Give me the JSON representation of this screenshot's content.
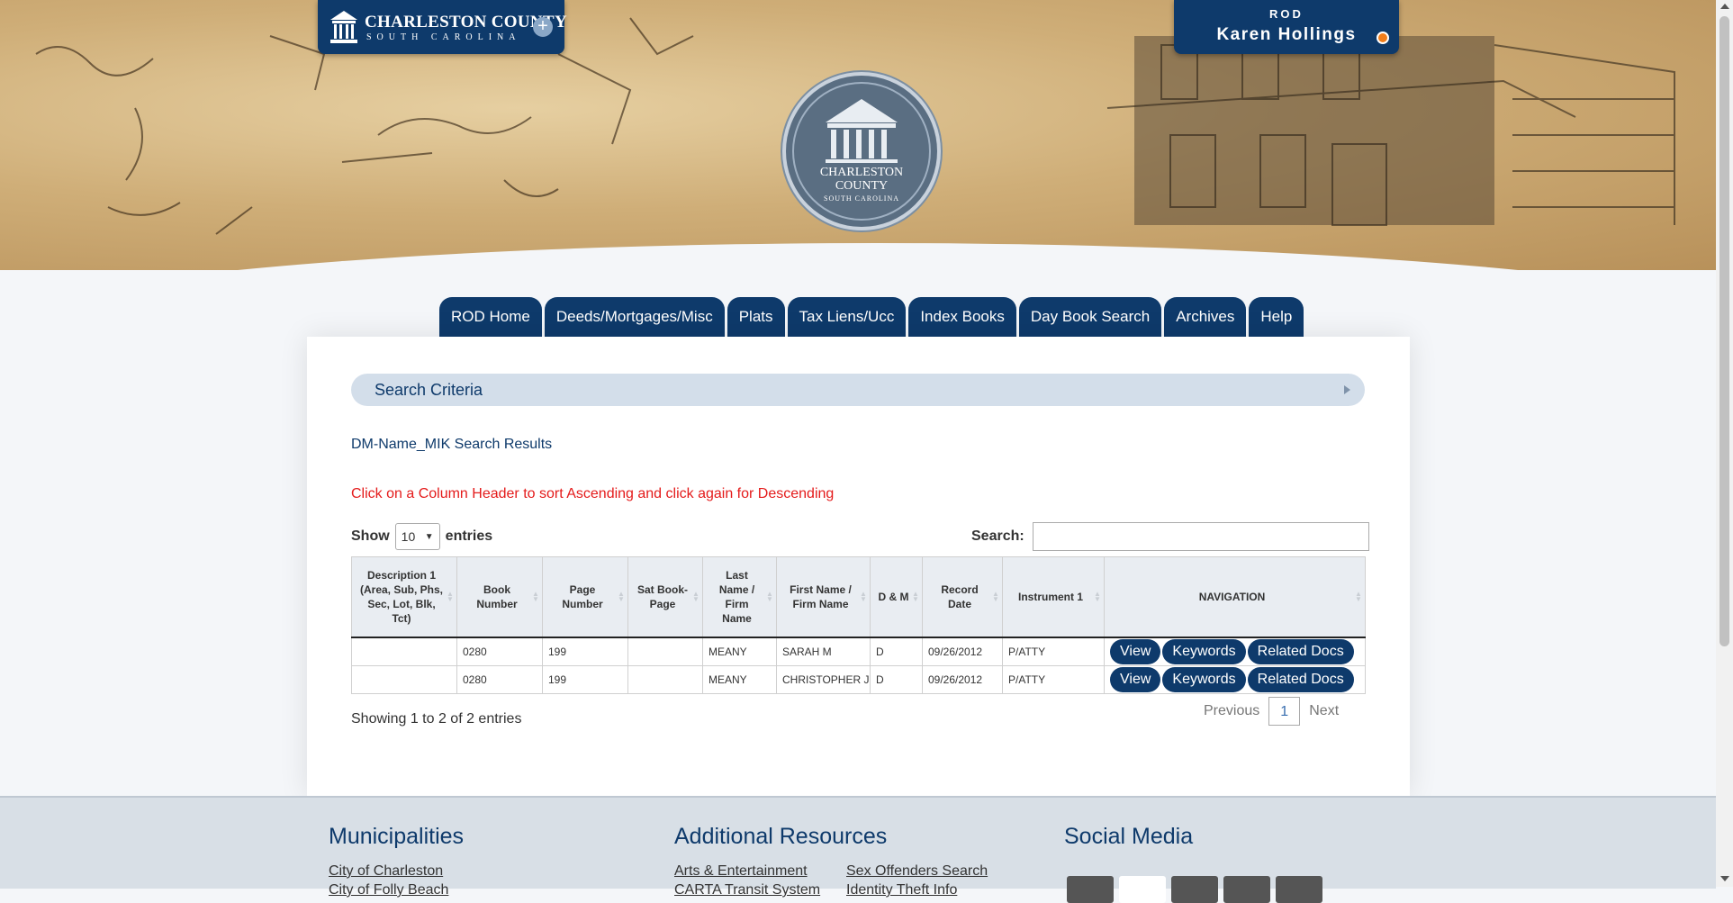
{
  "header": {
    "logo_line1": "CHARLESTON COUNTY",
    "logo_line2": "SOUTH CAROLINA",
    "logo_icon": "building-icon",
    "expand_icon": "plus-icon",
    "user_role": "ROD",
    "user_name": "Karen Hollings",
    "status_color": "#f07d1a",
    "seal": {
      "line1": "CHARLESTON",
      "line2": "COUNTY",
      "line3": "SOUTH CAROLINA"
    }
  },
  "nav": {
    "tabs": [
      {
        "label": "ROD Home"
      },
      {
        "label": "Deeds/Mortgages/Misc"
      },
      {
        "label": "Plats"
      },
      {
        "label": "Tax Liens/Ucc"
      },
      {
        "label": "Index Books"
      },
      {
        "label": "Day Book Search"
      },
      {
        "label": "Archives"
      },
      {
        "label": "Help"
      }
    ]
  },
  "main": {
    "criteria_label": "Search Criteria",
    "results_title": "DM-Name_MIK Search Results",
    "sort_hint": "Click on a Column Header to sort Ascending and click again for Descending",
    "show_label": "Show",
    "entries_value": "10",
    "entries_label": "entries",
    "search_label": "Search:",
    "search_value": "",
    "columns": [
      "Description 1 (Area, Sub, Phs, Sec, Lot, Blk, Tct)",
      "Book Number",
      "Page Number",
      "Sat Book-Page",
      "Last Name / Firm Name",
      "First Name / Firm Name",
      "D & M",
      "Record Date",
      "Instrument 1",
      "NAVIGATION"
    ],
    "rows": [
      {
        "desc": "",
        "book": "0280",
        "page": "199",
        "sat": "",
        "last": "MEANY",
        "first": "SARAH M",
        "dm": "D",
        "date": "09/26/2012",
        "instrument": "P/ATTY"
      },
      {
        "desc": "",
        "book": "0280",
        "page": "199",
        "sat": "",
        "last": "MEANY",
        "first": "CHRISTOPHER J",
        "dm": "D",
        "date": "09/26/2012",
        "instrument": "P/ATTY"
      }
    ],
    "buttons": {
      "view": "View",
      "keywords": "Keywords",
      "related": "Related Docs"
    },
    "info": "Showing 1 to 2 of 2 entries",
    "pager": {
      "previous": "Previous",
      "current": "1",
      "next": "Next"
    }
  },
  "footer": {
    "municipalities": {
      "title": "Municipalities",
      "links": [
        "City of Charleston",
        "City of Folly Beach"
      ]
    },
    "resources": {
      "title": "Additional Resources",
      "col1": [
        "Arts & Entertainment",
        "CARTA Transit System"
      ],
      "col2": [
        "Sex Offenders Search",
        "Identity Theft Info"
      ]
    },
    "social": {
      "title": "Social Media",
      "icons": [
        "facebook-icon",
        "x-icon",
        "youtube-icon",
        "linkedin-icon",
        "instagram-icon"
      ]
    }
  },
  "colors": {
    "brand_navy": "#0e3a6b",
    "hint_red": "#e41b1b",
    "criteria_bg": "#d3deea"
  }
}
